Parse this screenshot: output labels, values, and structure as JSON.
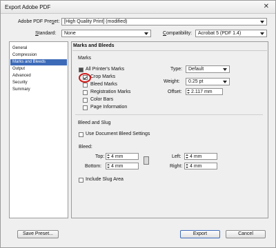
{
  "window": {
    "title": "Export Adobe PDF",
    "close_glyph": "✕"
  },
  "preset": {
    "label_pre": "Adobe PDF Pre",
    "label_u": "s",
    "label_post": "et:",
    "value": "[High Quality Print] (modified)"
  },
  "standard": {
    "label_u": "S",
    "label_post": "tandard:",
    "value": "None"
  },
  "compatibility": {
    "label_u": "C",
    "label_post": "ompatibility:",
    "value": "Acrobat 5 (PDF 1.4)"
  },
  "sidebar": {
    "items": [
      {
        "label": "General"
      },
      {
        "label": "Compression"
      },
      {
        "label": "Marks and Bleeds"
      },
      {
        "label": "Output"
      },
      {
        "label": "Advanced"
      },
      {
        "label": "Security"
      },
      {
        "label": "Summary"
      }
    ]
  },
  "section": {
    "title": "Marks and Bleeds"
  },
  "marks": {
    "group_title": "Marks",
    "all_printers": "All Printer's Marks",
    "crop": "Crop Marks",
    "bleed": "Bleed Marks",
    "registration": "Registration Marks",
    "color_bars": "Color Bars",
    "page_info": "Page Information",
    "type_label": "Type:",
    "type_value": "Default",
    "weight_label": "Weight:",
    "weight_value": "0.25 pt",
    "offset_label": "Offset:",
    "offset_value": "2.117 mm"
  },
  "bleed": {
    "group_title": "Bleed and Slug",
    "use_doc": "Use Document Bleed Settings",
    "bleed_label": "Bleed:",
    "top_label": "Top:",
    "top_value": "4 mm",
    "bottom_label": "Bottom:",
    "bottom_value": "4 mm",
    "left_label": "Left:",
    "left_value": "4 mm",
    "right_label": "Right:",
    "right_value": "4 mm",
    "include_slug": "Include Slug Area"
  },
  "buttons": {
    "save_preset": "Save Preset...",
    "export": "Export",
    "cancel": "Cancel"
  }
}
